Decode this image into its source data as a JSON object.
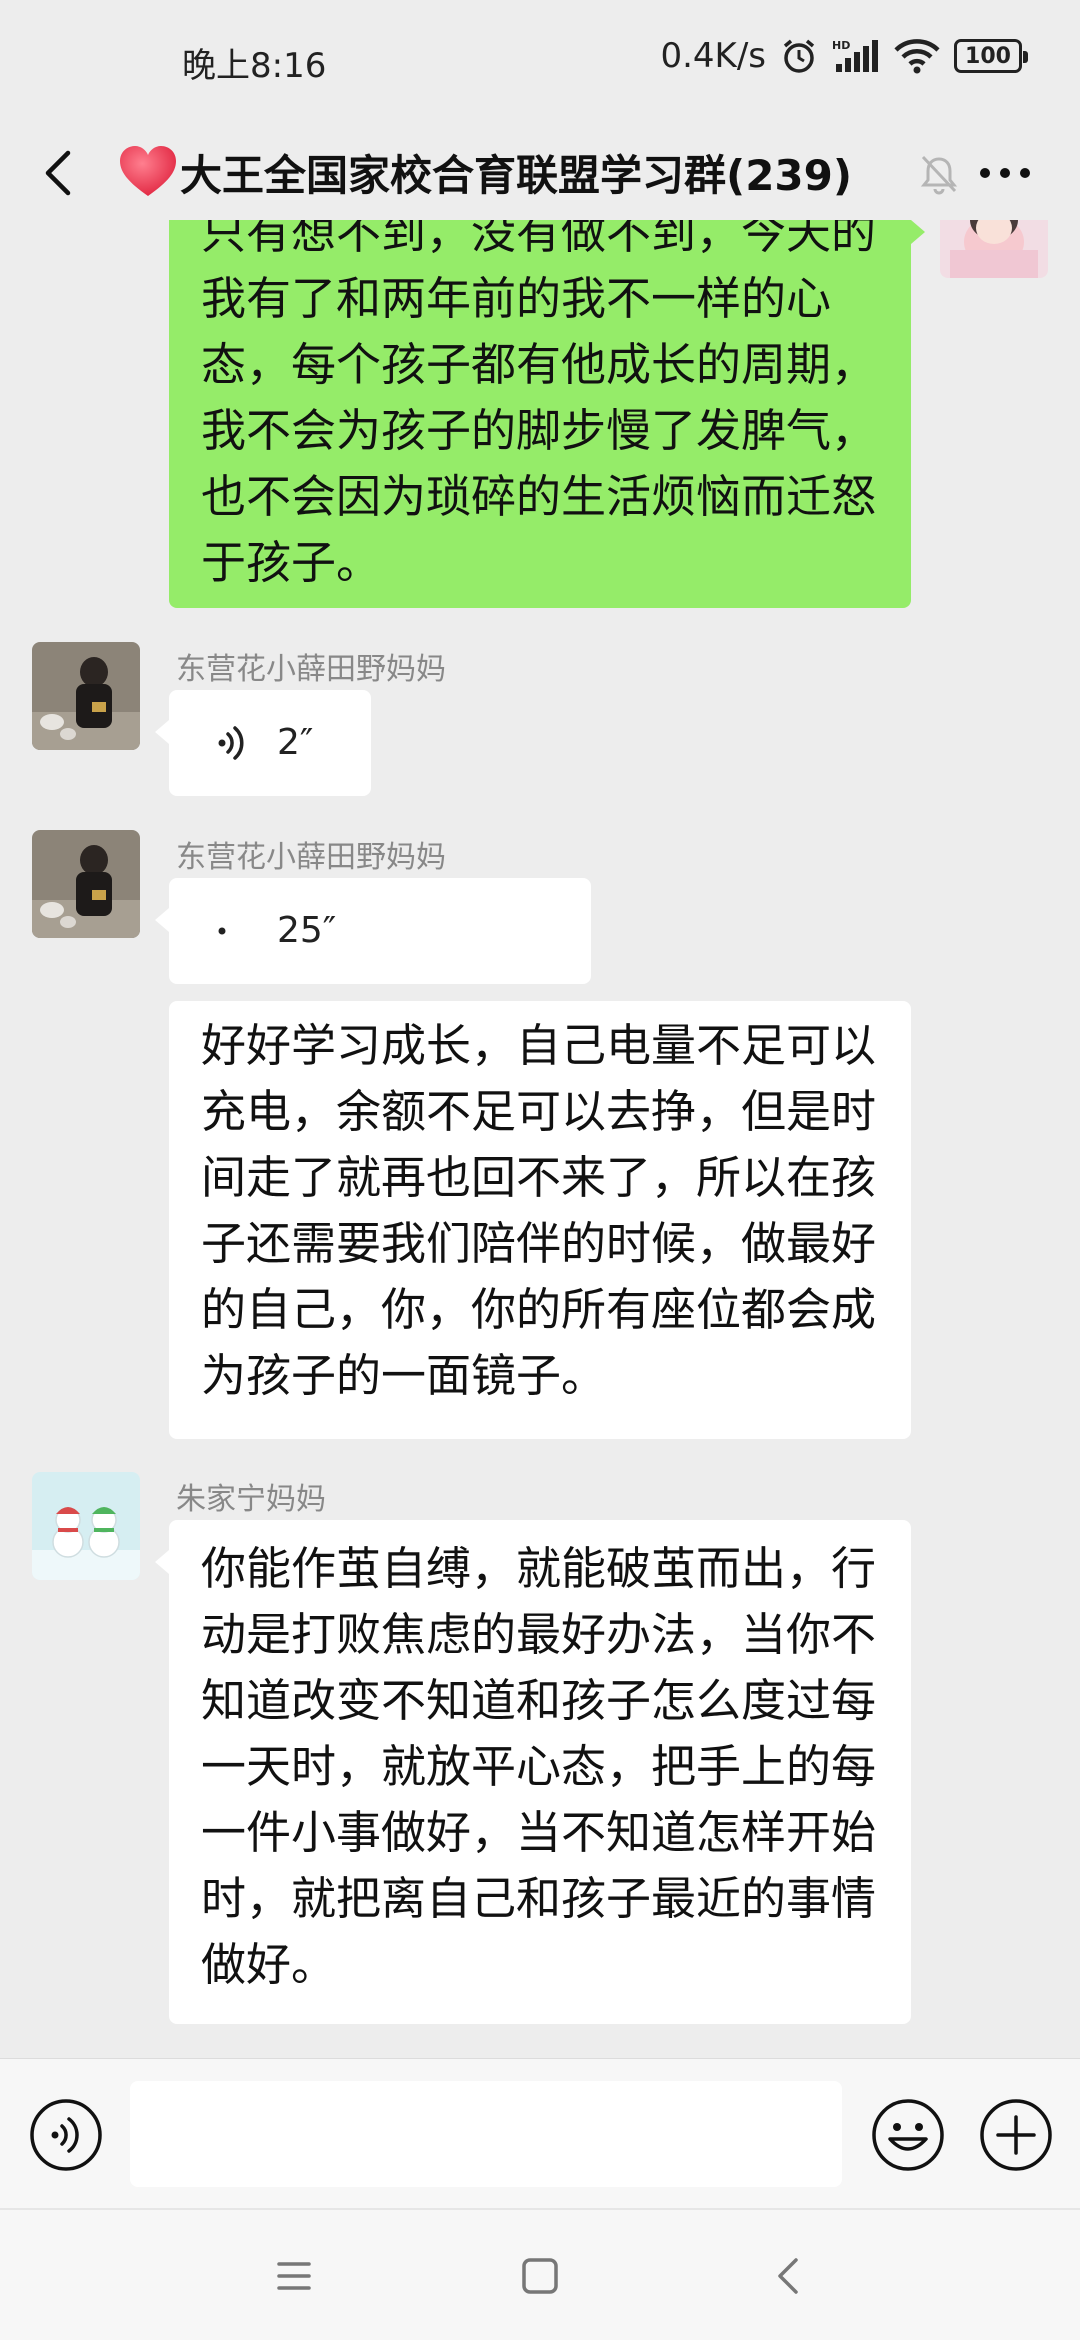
{
  "status_bar": {
    "time": "晚上8:16",
    "network_speed": "0.4K/s",
    "battery": "100",
    "icons": [
      "alarm-icon",
      "hd-signal-icon",
      "wifi-icon",
      "battery-icon"
    ]
  },
  "header": {
    "title": "大王全国家校合育联盟学习群(239)",
    "title_emoji": "heart-icon",
    "icons": [
      "back-icon",
      "mute-bell-icon",
      "more-icon"
    ]
  },
  "messages": [
    {
      "id": "m1",
      "side": "right",
      "type": "text",
      "lines": [
        "只有想不到，没有做不到，今天的",
        "我有了和两年前的我不一样的心",
        "态，每个孩子都有他成长的周期，",
        "我不会为孩子的脚步慢了发脾气，",
        "也不会因为琐碎的生活烦恼而迁怒",
        "于孩子。"
      ]
    },
    {
      "id": "m2",
      "side": "left",
      "sender": "东营花小薛田野妈妈",
      "type": "voice",
      "duration": "2″"
    },
    {
      "id": "m3",
      "side": "left",
      "sender": "东营花小薛田野妈妈",
      "type": "voice",
      "duration": "25″"
    },
    {
      "id": "m4",
      "side": "left",
      "type": "text",
      "lines": [
        "好好学习成长，自己电量不足可以",
        "充电，余额不足可以去挣，但是时",
        "间走了就再也回不来了，所以在孩",
        "子还需要我们陪伴的时候，做最好",
        "的自己，你，你的所有座位都会成",
        "为孩子的一面镜子。"
      ]
    },
    {
      "id": "m5",
      "side": "left",
      "sender": "朱家宁妈妈",
      "type": "text",
      "lines": [
        "你能作茧自缚，就能破茧而出，行",
        "动是打败焦虑的最好办法，当你不",
        "知道改变不知道和孩子怎么度过每",
        "一天时，就放平心态，把手上的每",
        "一件小事做好，当不知道怎样开始",
        "时，就把离自己和孩子最近的事情",
        "做好。"
      ]
    }
  ],
  "input_bar": {
    "text_value": "",
    "icons": [
      "voice-input-icon",
      "emoji-icon",
      "plus-icon"
    ]
  },
  "nav_bar": {
    "icons": [
      "menu-icon",
      "home-icon",
      "back-nav-icon"
    ]
  },
  "colors": {
    "background": "#ededed",
    "sent_bubble": "#95ec69",
    "received_bubble": "#ffffff",
    "sender_name": "#888888",
    "title_heart": "#e8344e"
  }
}
